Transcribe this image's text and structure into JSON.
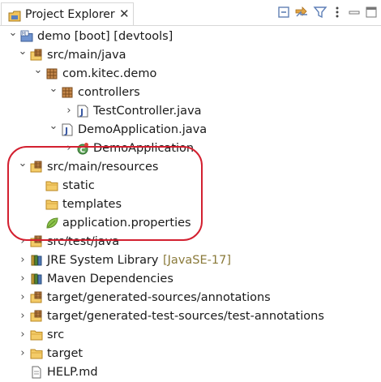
{
  "view": {
    "title": "Project Explorer",
    "close": "✕",
    "toolbar": [
      "collapse-all-icon",
      "link-with-editor-icon",
      "filter-icon",
      "view-menu-icon",
      "minimize-icon",
      "maximize-icon"
    ]
  },
  "tree": [
    {
      "label": "demo [boot] [devtools]",
      "expanded": true,
      "icon": "project-icon"
    },
    {
      "label": "src/main/java",
      "expanded": true,
      "icon": "source-folder-icon"
    },
    {
      "label": "com.kitec.demo",
      "expanded": true,
      "icon": "package-icon"
    },
    {
      "label": "controllers",
      "expanded": true,
      "icon": "package-icon"
    },
    {
      "label": "TestController.java",
      "expanded": false,
      "icon": "java-file-icon"
    },
    {
      "label": "DemoApplication.java",
      "expanded": true,
      "icon": "java-file-icon"
    },
    {
      "label": "DemoApplication",
      "expanded": false,
      "icon": "class-icon"
    },
    {
      "label": "src/main/resources",
      "expanded": true,
      "icon": "source-folder-icon"
    },
    {
      "label": "static",
      "icon": "folder-icon"
    },
    {
      "label": "templates",
      "icon": "folder-icon"
    },
    {
      "label": "application.properties",
      "icon": "spring-properties-icon"
    },
    {
      "label": "src/test/java",
      "expanded": false,
      "icon": "source-folder-icon"
    },
    {
      "label": "JRE System Library",
      "decoration": "[JavaSE-17]",
      "expanded": false,
      "icon": "library-icon"
    },
    {
      "label": "Maven Dependencies",
      "expanded": false,
      "icon": "library-icon"
    },
    {
      "label": "target/generated-sources/annotations",
      "expanded": false,
      "icon": "source-folder-icon"
    },
    {
      "label": "target/generated-test-sources/test-annotations",
      "expanded": false,
      "icon": "source-folder-icon"
    },
    {
      "label": "src",
      "expanded": false,
      "icon": "folder-icon"
    },
    {
      "label": "target",
      "expanded": false,
      "icon": "folder-icon"
    },
    {
      "label": "HELP.md",
      "icon": "file-icon"
    }
  ],
  "colors": {
    "highlight_ring": "#d32030",
    "folder": "#e8b64a",
    "package": "#a86e2a",
    "library": "#6d8e3a"
  }
}
